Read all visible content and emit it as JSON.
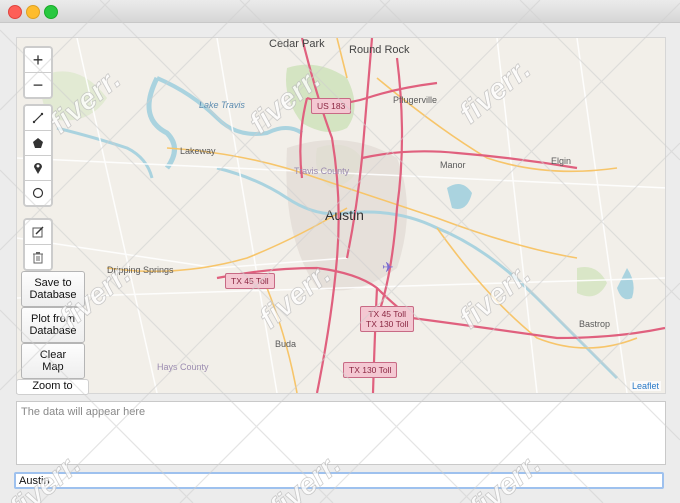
{
  "window": {
    "title": ""
  },
  "map": {
    "zoom_in": "+",
    "zoom_out": "−",
    "tools": [
      {
        "name": "polyline-icon",
        "glyph": "⟋"
      },
      {
        "name": "polygon-icon",
        "glyph": "⬟"
      },
      {
        "name": "marker-icon",
        "glyph": "⚲"
      },
      {
        "name": "circle-icon",
        "glyph": "◯"
      }
    ],
    "edit_tools": [
      {
        "name": "edit-icon",
        "glyph": "✎"
      },
      {
        "name": "trash-icon",
        "glyph": "🗑"
      }
    ],
    "places": {
      "cedar_park": "Cedar Park",
      "round_rock": "Round Rock",
      "pflugerville": "Pflugerville",
      "lake_travis": "Lake Travis",
      "lakeway": "Lakeway",
      "travis_county": "Travis County",
      "manor": "Manor",
      "elgin": "Elgin",
      "austin": "Austin",
      "dripping_springs": "Dripping Springs",
      "buda": "Buda",
      "bastrop": "Bastrop",
      "hays_county": "Hays County"
    },
    "shields": {
      "us183": "US 183",
      "tx45_west": "TX 45 Toll",
      "tx45_tx130_line1": "TX 45 Toll",
      "tx45_tx130_line2": "TX 130 Toll",
      "tx130": "TX 130 Toll"
    },
    "attribution": "Leaflet"
  },
  "buttons": {
    "save_line1": "Save to",
    "save_line2": "Database",
    "plot_line1": "Plot from",
    "plot_line2": "Database",
    "clear_line1": "Clear",
    "clear_line2": "Map",
    "zoom_to": "Zoom to"
  },
  "output": {
    "placeholder": "The data will appear here"
  },
  "search": {
    "value": "Austin"
  },
  "watermark": "fiverr."
}
